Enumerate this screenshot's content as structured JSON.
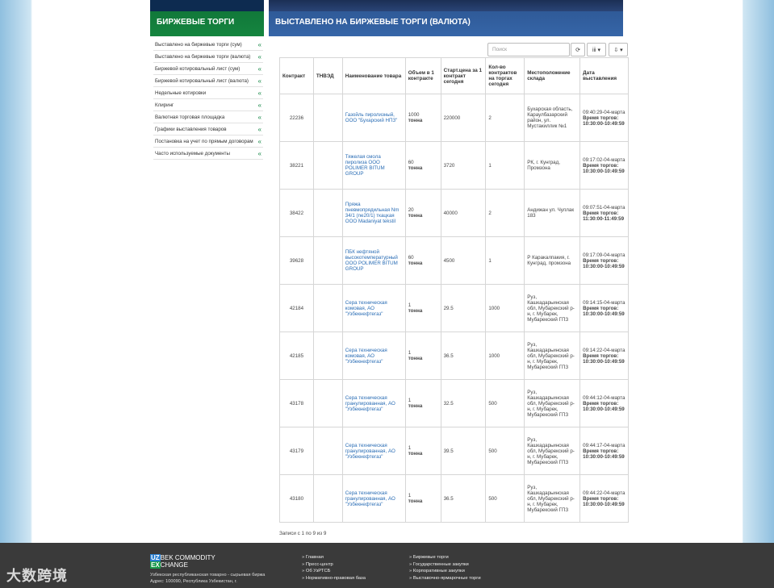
{
  "header": {
    "left_title": "БИРЖЕВЫЕ ТОРГИ",
    "right_title": "ВЫСТАВЛЕНО НА БИРЖЕВЫЕ ТОРГИ (ВАЛЮТА)"
  },
  "sidebar": {
    "items": [
      {
        "label": "Выставлено на биржевые торги (сум)"
      },
      {
        "label": "Выставлено на биржевые торги (валюта)"
      },
      {
        "label": "Биржевой котировальный лист (сум)"
      },
      {
        "label": "Биржевой котировальный лист (валюта)"
      },
      {
        "label": "Недельные котировки"
      },
      {
        "label": "Клиринг"
      },
      {
        "label": "Валютная торговая площадка"
      },
      {
        "label": "Графики выставления товаров"
      },
      {
        "label": "Постановка на учет по прямым договорам"
      },
      {
        "label": "Часто используемые документы"
      }
    ],
    "chevron": "«"
  },
  "toolbar": {
    "search_placeholder": "Поиск",
    "refresh_icon": "⟳",
    "columns_icon": "iii ▾",
    "export_icon": "⇩ ▾"
  },
  "table": {
    "headers": {
      "contract": "Контракт",
      "tnved": "ТНВЭД",
      "name": "Наименование товара",
      "volume": "Объем в 1 контракте",
      "price": "Старт.цена за 1 контракт сегодня",
      "qty": "Кол-во контрактов на торгах сегодня",
      "warehouse": "Местоположение склада",
      "date": "Дата выставления"
    },
    "rows": [
      {
        "contract": "22236",
        "name": "Газойль пиролизный, ООО \"Бухарский НПЗ\"",
        "vol_num": "1000",
        "vol_unit": "тонна",
        "price": "220000",
        "qty": "2",
        "warehouse": "Бухарская область, Караулбазарский район, ул. Мустакиллик №1",
        "date": "09:40:29-04-марта",
        "time_label": "Время торгов:",
        "time": "10:30:00-10:49:59"
      },
      {
        "contract": "38221",
        "name": "Тяжелая смола пиролиза ООО POLIMER BITUM GROUP",
        "vol_num": "60",
        "vol_unit": "тонна",
        "price": "3720",
        "qty": "1",
        "warehouse": "РК, г. Кунград, Промзона",
        "date": "09:17:02-04-марта",
        "time_label": "Время торгов:",
        "time": "10:30:00-10:49:59"
      },
      {
        "contract": "38422",
        "name": "Пряжа пневмопрядильная Nm 34/1 (ne20/1) ткацкая ООО Madaniyat tekstil",
        "vol_num": "20",
        "vol_unit": "тонна",
        "price": "40000",
        "qty": "2",
        "warehouse": "Андижан ул. Чуллак 183",
        "date": "09:07:51-04-марта",
        "time_label": "Время торгов:",
        "time": "11:30:00-11:49:59"
      },
      {
        "contract": "39628",
        "name": "ПБК нефтяной высокотемпературный ООО POLIMER BITUM GROUP",
        "vol_num": "60",
        "vol_unit": "тонна",
        "price": "4500",
        "qty": "1",
        "warehouse": "Р Каракалпакия, г. Кунград, промзона",
        "date": "09:17:09-04-марта",
        "time_label": "Время торгов:",
        "time": "10:30:00-10:49:59"
      },
      {
        "contract": "42184",
        "name": "Сера техническая комовая, АО \"Узбекнефтегаз\"",
        "vol_num": "1",
        "vol_unit": "тонна",
        "price": "29.5",
        "qty": "1000",
        "warehouse": "Руз, Кашкадарьинская обл, Мубарекский р-н, г. Мубарек, Мубарекский ГПЗ",
        "date": "09:14:15-04-марта",
        "time_label": "Время торгов:",
        "time": "10:30:00-10:49:59"
      },
      {
        "contract": "42185",
        "name": "Сера техническая комовая, АО \"Узбекнефтегаз\"",
        "vol_num": "1",
        "vol_unit": "тонна",
        "price": "36.5",
        "qty": "1000",
        "warehouse": "Руз, Кашкадарьинская обл, Мубарекский р-н, г. Мубарек, Мубарекский ГПЗ",
        "date": "09:14:22-04-марта",
        "time_label": "Время торгов:",
        "time": "10:30:00-10:49:59"
      },
      {
        "contract": "43178",
        "name": "Сера техническая гранулированная, АО \"Узбекнефтегаз\"",
        "vol_num": "1",
        "vol_unit": "тонна",
        "price": "32.5",
        "qty": "500",
        "warehouse": "Руз, Кашкадарьинская обл, Мубарекский р-н, г. Мубарек, Мубарекский ГПЗ",
        "date": "09:44:12-04-марта",
        "time_label": "Время торгов:",
        "time": "10:30:00-10:49:59"
      },
      {
        "contract": "43179",
        "name": "Сера техническая гранулированная, АО \"Узбекнефтегаз\"",
        "vol_num": "1",
        "vol_unit": "тонна",
        "price": "39.5",
        "qty": "500",
        "warehouse": "Руз, Кашкадарьинская обл, Мубарекский р-н, г. Мубарек, Мубарекский ГПЗ",
        "date": "09:44:17-04-марта",
        "time_label": "Время торгов:",
        "time": "10:30:00-10:49:59"
      },
      {
        "contract": "43180",
        "name": "Сера техническая гранулированная, АО \"Узбекнефтегаз\"",
        "vol_num": "1",
        "vol_unit": "тонна",
        "price": "36.5",
        "qty": "500",
        "warehouse": "Руз, Кашкадарьинская обл, Мубарекский р-н, г. Мубарек, Мубарекский ГПЗ",
        "date": "09:44:22-04-марта",
        "time_label": "Время торгов:",
        "time": "10:30:00-10:49:59"
      }
    ]
  },
  "records_text": "Записи с 1 по 9 из 9",
  "footer": {
    "logo_uz": "UZ",
    "logo_ex": "EX",
    "logo_line1": "BEK COMMODITY",
    "logo_line2": "CHANGE",
    "org": "Узбекская республиканская товарно - сырьевая биржа Адрес: 100090, Республика Узбекистан, г.",
    "col1": [
      "Главная",
      "Пресс-центр",
      "Об УзРТСБ",
      "Нормативно-правовая база"
    ],
    "col2": [
      "Биржевые торги",
      "Государственные закупки",
      "Корпоративные закупки",
      "Выставочно-ярмарочные торги"
    ],
    "watermark": "大数跨境"
  }
}
